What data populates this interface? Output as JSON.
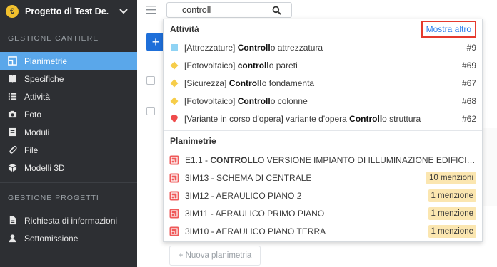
{
  "sidebar": {
    "project_name": "Progetto di Test De...",
    "logo_letter": "€",
    "section1": "GESTIONE CANTIERE",
    "section2": "GESTIONE PROGETTI",
    "items1": [
      {
        "label": "Planimetrie",
        "icon": "floorplan-icon",
        "active": true
      },
      {
        "label": "Specifiche",
        "icon": "book-icon"
      },
      {
        "label": "Attività",
        "icon": "list-icon"
      },
      {
        "label": "Foto",
        "icon": "camera-icon"
      },
      {
        "label": "Moduli",
        "icon": "form-icon"
      },
      {
        "label": "File",
        "icon": "paperclip-icon"
      },
      {
        "label": "Modelli 3D",
        "icon": "cube-icon"
      }
    ],
    "items2": [
      {
        "label": "Richiesta di informazioni",
        "icon": "document-icon"
      },
      {
        "label": "Sottomissione",
        "icon": "person-icon"
      }
    ]
  },
  "search": {
    "value": "controll"
  },
  "background": {
    "add_symbol": "+",
    "new_plan": "+ Nuova planimetria"
  },
  "dropdown": {
    "activities_title": "Attività",
    "more_label": "Mostra altro",
    "activities": [
      {
        "pre": "[Attrezzature] ",
        "match": "Controll",
        "post": "o attrezzatura",
        "num": "#9",
        "color": "#8fd3f4",
        "shape": "square"
      },
      {
        "pre": "[Fotovoltaico] ",
        "match": "controll",
        "post": "o pareti",
        "num": "#69",
        "color": "#f6cd4a",
        "shape": "diamond"
      },
      {
        "pre": "[Sicurezza] ",
        "match": "Controll",
        "post": "o fondamenta",
        "num": "#67",
        "color": "#f6cd4a",
        "shape": "diamond"
      },
      {
        "pre": "[Fotovoltaico] ",
        "match": "Controll",
        "post": "o colonne",
        "num": "#68",
        "color": "#f6cd4a",
        "shape": "diamond"
      },
      {
        "pre": "[Variante in corso d'opera] variante d'opera ",
        "match": "Controll",
        "post": "o struttura",
        "num": "#62",
        "color": "#ef4b4b",
        "shape": "pin"
      }
    ],
    "plans_title": "Planimetrie",
    "plans": [
      {
        "pre": "E1.1 - ",
        "match": "CONTROLL",
        "post": "O VERSIONE IMPIANTO DI ILLUMINAZIONE EDIFICIO ES...",
        "badge": ""
      },
      {
        "pre": "3IM13 - SCHEMA DI CENTRALE",
        "match": "",
        "post": "",
        "badge": "10 menzioni"
      },
      {
        "pre": "3IM12 - AERAULICO PIANO 2",
        "match": "",
        "post": "",
        "badge": "1 menzione"
      },
      {
        "pre": "3IM11 - AERAULICO PRIMO PIANO",
        "match": "",
        "post": "",
        "badge": "1 menzione"
      },
      {
        "pre": "3IM10 - AERAULICO PIANO TERRA",
        "match": "",
        "post": "",
        "badge": "1 menzione"
      }
    ]
  }
}
